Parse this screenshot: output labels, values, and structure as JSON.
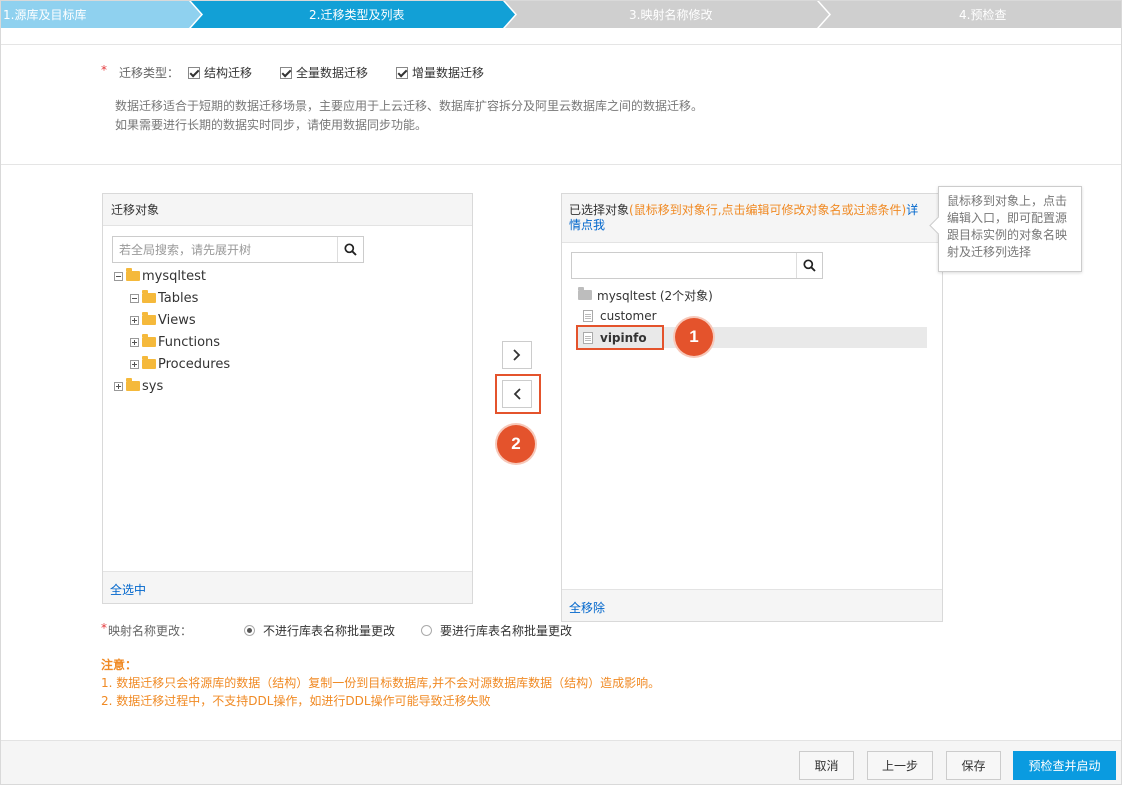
{
  "steps": [
    {
      "label": "1.源库及目标库",
      "state": "done"
    },
    {
      "label": "2.迁移类型及列表",
      "state": "active"
    },
    {
      "label": "3.映射名称修改",
      "state": "todo"
    },
    {
      "label": "4.预检查",
      "state": "todo"
    }
  ],
  "colors": {
    "done": "#8fd1ef",
    "active": "#12a0d6",
    "todo": "#cfcfcf",
    "accent": "#e4532c",
    "link": "#0066cc",
    "warning": "#f08a24"
  },
  "migration_type": {
    "required_mark": "*",
    "label": "迁移类型：",
    "options": [
      {
        "label": "结构迁移",
        "checked": true
      },
      {
        "label": "全量数据迁移",
        "checked": true
      },
      {
        "label": "增量数据迁移",
        "checked": true
      }
    ],
    "description": [
      "数据迁移适合于短期的数据迁移场景，主要应用于上云迁移、数据库扩容拆分及阿里云数据库之间的数据迁移。",
      "如果需要进行长期的数据实时同步，请使用数据同步功能。"
    ]
  },
  "source_panel": {
    "title": "迁移对象",
    "search_placeholder": "若全局搜索，请先展开树",
    "tree": [
      {
        "label": "mysqltest",
        "level": 0,
        "toggle": "minus"
      },
      {
        "label": "Tables",
        "level": 1,
        "toggle": "minus"
      },
      {
        "label": "Views",
        "level": 1,
        "toggle": "plus"
      },
      {
        "label": "Functions",
        "level": 1,
        "toggle": "plus"
      },
      {
        "label": "Procedures",
        "level": 1,
        "toggle": "plus"
      },
      {
        "label": "sys",
        "level": 0,
        "toggle": "plus"
      }
    ],
    "footer": "全选中"
  },
  "selected_panel": {
    "title": "已选择对象",
    "hint": "(鼠标移到对象行,点击编辑可修改对象名或过滤条件)",
    "more_link_1": "详",
    "more_link_2": "情点我",
    "search_value": "",
    "group": "mysqltest (2个对象)",
    "items": [
      {
        "label": "customer",
        "selected": false
      },
      {
        "label": "vipinfo",
        "selected": true
      }
    ],
    "footer": "全移除"
  },
  "tooltip": {
    "lines": [
      "鼠标移到对象上，点击",
      "编辑入口，即可配置源",
      "跟目标实例的对象名映",
      "射及迁移列选择"
    ]
  },
  "transfer": {
    "right_icon": "chevron-right-icon",
    "left_icon": "chevron-left-icon"
  },
  "callouts": [
    "1",
    "2"
  ],
  "mapping": {
    "required_mark": "*",
    "label": "映射名称更改：",
    "options": [
      {
        "label": "不进行库表名称批量更改",
        "selected": true
      },
      {
        "label": "要进行库表名称批量更改",
        "selected": false
      }
    ]
  },
  "notes": {
    "title": "注意：",
    "lines": [
      "1. 数据迁移只会将源库的数据（结构）复制一份到目标数据库,并不会对源数据库数据（结构）造成影响。",
      "2. 数据迁移过程中，不支持DDL操作，如进行DDL操作可能导致迁移失败"
    ]
  },
  "buttons": {
    "cancel": "取消",
    "prev": "上一步",
    "save": "保存",
    "start": "预检查并启动"
  }
}
